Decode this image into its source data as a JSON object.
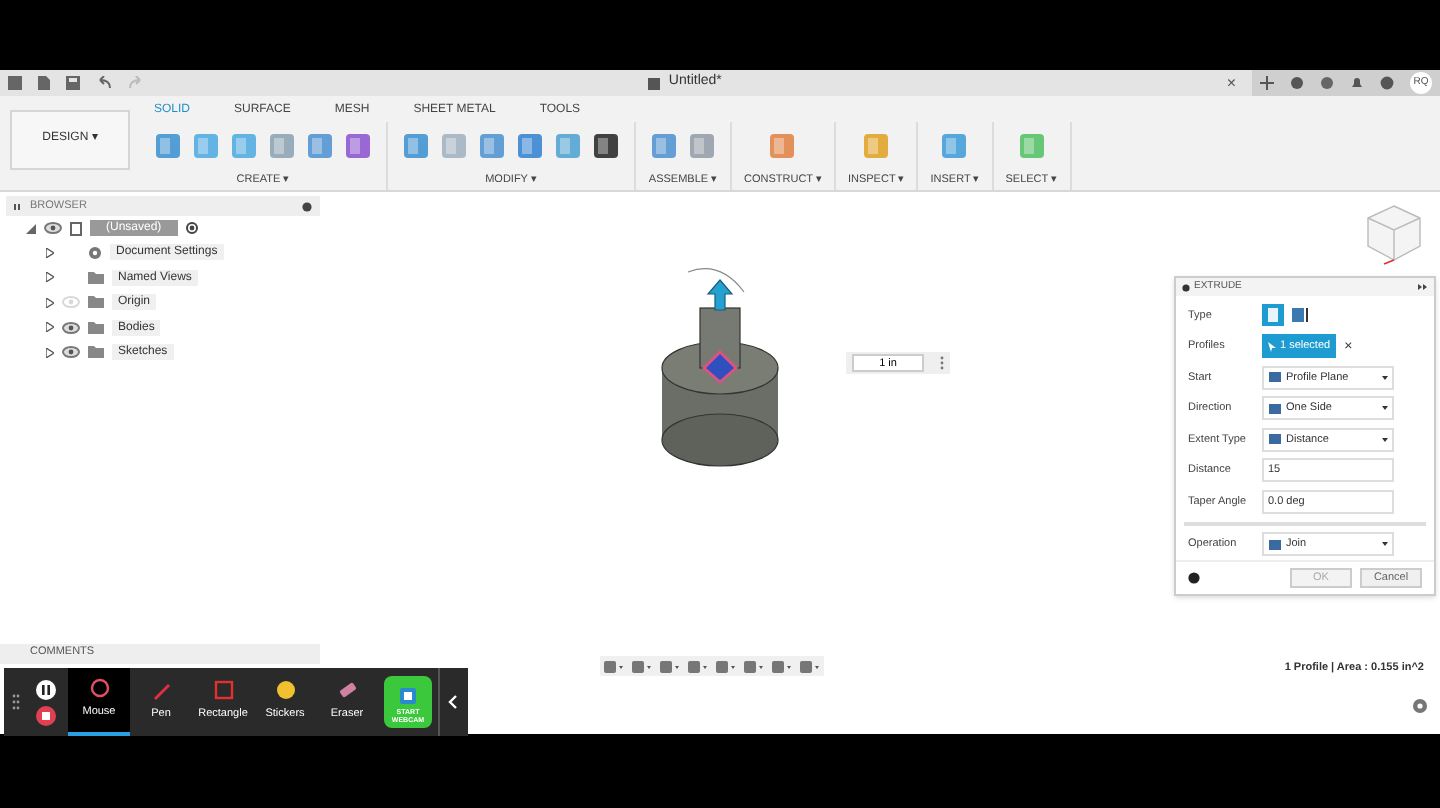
{
  "top_bar": {
    "title": "Untitled*",
    "close": "×",
    "user": "RQ"
  },
  "workspace": {
    "label": "DESIGN",
    "caret": "▾"
  },
  "tabs": [
    {
      "label": "SOLID",
      "selected": true
    },
    {
      "label": "SURFACE",
      "selected": false
    },
    {
      "label": "MESH",
      "selected": false
    },
    {
      "label": "SHEET METAL",
      "selected": false
    },
    {
      "label": "TOOLS",
      "selected": false
    }
  ],
  "tool_groups": [
    {
      "label": "CREATE ▾"
    },
    {
      "label": "MODIFY ▾"
    },
    {
      "label": "ASSEMBLE ▾"
    },
    {
      "label": "CONSTRUCT ▾"
    },
    {
      "label": "INSPECT ▾"
    },
    {
      "label": "INSERT ▾"
    },
    {
      "label": "SELECT ▾"
    }
  ],
  "browser": {
    "title": "BROWSER",
    "root": {
      "label": "(Unsaved)",
      "children": [
        {
          "label": "Document Settings",
          "kind": "settings",
          "has_eye": false
        },
        {
          "label": "Named Views",
          "kind": "folder",
          "has_eye": false
        },
        {
          "label": "Origin",
          "kind": "folder",
          "has_eye": true,
          "visible": false
        },
        {
          "label": "Bodies",
          "kind": "folder",
          "has_eye": true,
          "visible": true
        },
        {
          "label": "Sketches",
          "kind": "folder",
          "has_eye": true,
          "visible": true
        }
      ]
    }
  },
  "dimension_input": {
    "value": "1 in"
  },
  "extrude": {
    "title": "EXTRUDE",
    "rows": [
      {
        "label": "Type",
        "kind": "type"
      },
      {
        "label": "Profiles",
        "kind": "chip",
        "value": "1 selected",
        "clear": "×"
      },
      {
        "label": "Start",
        "kind": "dropdown",
        "value": "Profile Plane"
      },
      {
        "label": "Direction",
        "kind": "dropdown",
        "value": "One Side"
      },
      {
        "label": "Extent Type",
        "kind": "dropdown",
        "value": "Distance"
      },
      {
        "label": "Distance",
        "kind": "input",
        "value": "15"
      },
      {
        "label": "Taper Angle",
        "kind": "input",
        "value": "0.0 deg"
      },
      {
        "label": "Operation",
        "kind": "dropdown",
        "value": "Join"
      }
    ],
    "buttons": [
      {
        "label": "OK",
        "disabled": true
      },
      {
        "label": "Cancel",
        "disabled": false
      }
    ]
  },
  "comments": {
    "title": "COMMENTS"
  },
  "status": "1 Profile | Area : 0.155 in^2",
  "recorder": {
    "tools": [
      {
        "label": "Mouse",
        "selected": true
      },
      {
        "label": "Pen",
        "selected": false
      },
      {
        "label": "Rectangle",
        "selected": false
      },
      {
        "label": "Stickers",
        "selected": false
      },
      {
        "label": "Eraser",
        "selected": false
      }
    ],
    "webcam": "START WEBCAM"
  }
}
